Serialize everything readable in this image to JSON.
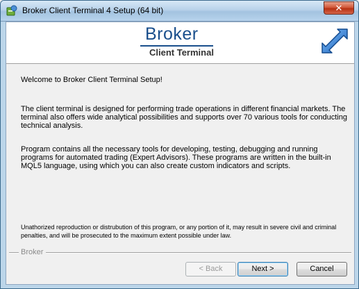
{
  "window": {
    "title": "Broker Client Terminal 4 Setup (64 bit)",
    "close_glyph": "✕"
  },
  "header": {
    "brand": "Broker",
    "subtitle": "Client Terminal"
  },
  "content": {
    "welcome": "Welcome to Broker Client Terminal  Setup!",
    "paragraph1": "The client terminal is designed for performing trade operations in different financial markets. The terminal also offers wide analytical possibilities and supports over 70 various tools for conducting technical analysis.",
    "paragraph2": "Program contains all the necessary tools for developing, testing, debugging and running programs for automated trading (Expert Advisors). These programs are written in the built-in MQL5 language, using which you can also create custom indicators and scripts.",
    "legal": "Unathorized reproduction or distrubution of this program, or any portion of it, may result in severe civil and criminal penalties, and will be prosecuted to the maximum extent possible under law."
  },
  "footer": {
    "group_label": "Broker",
    "back_label": "< Back",
    "next_label": "Next >",
    "cancel_label": "Cancel"
  },
  "icons": {
    "app": "setup-app-icon",
    "header": "double-arrow-icon"
  },
  "colors": {
    "brand": "#1a4f8c",
    "arrow": "#2a72c9"
  }
}
